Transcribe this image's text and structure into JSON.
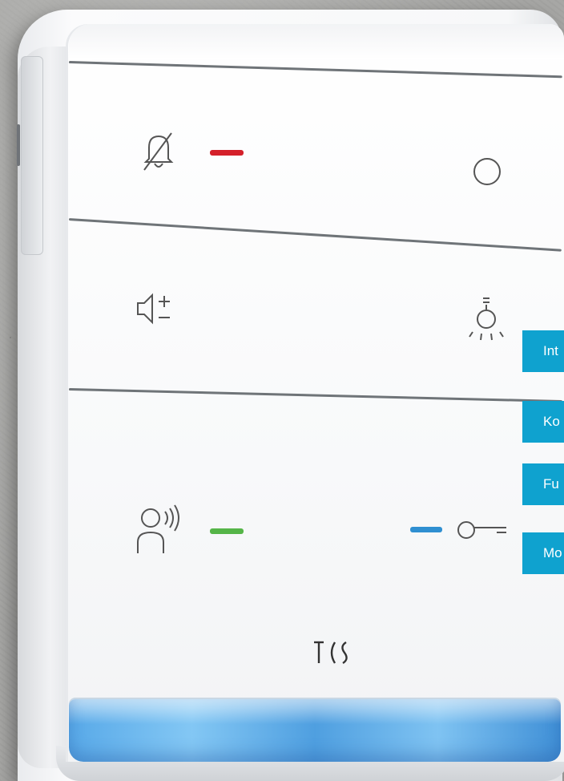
{
  "side_tabs": [
    {
      "label": "Int"
    },
    {
      "label": "Ko"
    },
    {
      "label": "Fu"
    },
    {
      "label": "Mo"
    }
  ],
  "device": {
    "brand_logo": "TCS",
    "colors": {
      "mute_indicator": "#d4202a",
      "talk_indicator": "#55b548",
      "door_indicator": "#2f8fd1",
      "tab_background": "#0fa2cf",
      "led_bar": "#58a9e8"
    },
    "buttons": [
      {
        "icon": "bell-mute-icon"
      },
      {
        "icon": "circle-icon"
      },
      {
        "icon": "volume-plus-minus-icon"
      },
      {
        "icon": "light-bulb-icon"
      },
      {
        "icon": "talk-person-icon"
      },
      {
        "icon": "door-key-icon"
      }
    ]
  }
}
